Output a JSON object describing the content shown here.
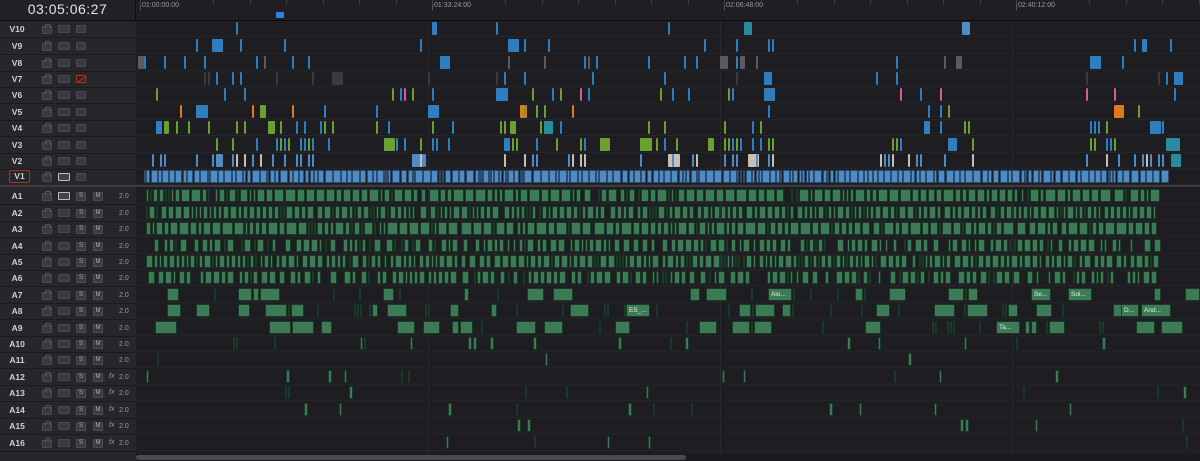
{
  "timecode": "03:05:06:27",
  "ruler": {
    "labels": [
      "01:00:00:00",
      "01:33:24:00",
      "02:06:48:00",
      "02:40:12:00"
    ]
  },
  "tracks": {
    "video": [
      {
        "name": "V10",
        "selected": false,
        "video_disabled": false
      },
      {
        "name": "V9",
        "selected": false,
        "video_disabled": false
      },
      {
        "name": "V8",
        "selected": false,
        "video_disabled": false
      },
      {
        "name": "V7",
        "selected": false,
        "video_disabled": true
      },
      {
        "name": "V6",
        "selected": false,
        "video_disabled": false
      },
      {
        "name": "V5",
        "selected": false,
        "video_disabled": false
      },
      {
        "name": "V4",
        "selected": false,
        "video_disabled": false
      },
      {
        "name": "V3",
        "selected": false,
        "video_disabled": false
      },
      {
        "name": "V2",
        "selected": false,
        "video_disabled": false
      },
      {
        "name": "V1",
        "selected": true,
        "video_disabled": false
      }
    ],
    "audio": [
      {
        "name": "A1",
        "solo": "S",
        "mute": "M",
        "fx": "",
        "format": "2.0"
      },
      {
        "name": "A2",
        "solo": "S",
        "mute": "M",
        "fx": "",
        "format": "2.0"
      },
      {
        "name": "A3",
        "solo": "S",
        "mute": "M",
        "fx": "",
        "format": "2.0"
      },
      {
        "name": "A4",
        "solo": "S",
        "mute": "M",
        "fx": "",
        "format": "2.0"
      },
      {
        "name": "A5",
        "solo": "S",
        "mute": "M",
        "fx": "",
        "format": "2.0"
      },
      {
        "name": "A6",
        "solo": "S",
        "mute": "M",
        "fx": "",
        "format": "2.0"
      },
      {
        "name": "A7",
        "solo": "S",
        "mute": "M",
        "fx": "",
        "format": "2.0"
      },
      {
        "name": "A8",
        "solo": "S",
        "mute": "M",
        "fx": "",
        "format": "2.0"
      },
      {
        "name": "A9",
        "solo": "S",
        "mute": "M",
        "fx": "",
        "format": "2.0"
      },
      {
        "name": "A10",
        "solo": "S",
        "mute": "M",
        "fx": "",
        "format": "2.0"
      },
      {
        "name": "A11",
        "solo": "S",
        "mute": "M",
        "fx": "",
        "format": "2.0"
      },
      {
        "name": "A12",
        "solo": "S",
        "mute": "M",
        "fx": "fx",
        "format": "2.0"
      },
      {
        "name": "A13",
        "solo": "S",
        "mute": "M",
        "fx": "fx",
        "format": "2.0"
      },
      {
        "name": "A14",
        "solo": "S",
        "mute": "M",
        "fx": "fx",
        "format": "2.0"
      },
      {
        "name": "A15",
        "solo": "S",
        "mute": "M",
        "fx": "fx",
        "format": "2.0"
      },
      {
        "name": "A16",
        "solo": "S",
        "mute": "M",
        "fx": "fx",
        "format": "2.0"
      }
    ]
  },
  "clip_labels": [
    {
      "track": "A7",
      "text": "Alo..."
    },
    {
      "track": "A7",
      "text": "Se..."
    },
    {
      "track": "A7",
      "text": "Sol..."
    },
    {
      "track": "A8",
      "text": "ES_..."
    },
    {
      "track": "A8",
      "text": "D..."
    },
    {
      "track": "A8",
      "text": "And..."
    },
    {
      "track": "A9",
      "text": "Ta..."
    }
  ],
  "clip_colors": {
    "video_v1": "#4f8bc5",
    "video_blue": "#2f7fc0",
    "video_pink": "#d85a9a",
    "video_orange": "#e07a20",
    "video_green": "#6aa030",
    "video_teal": "#2a8aa0",
    "audio": "#3d7a56"
  }
}
